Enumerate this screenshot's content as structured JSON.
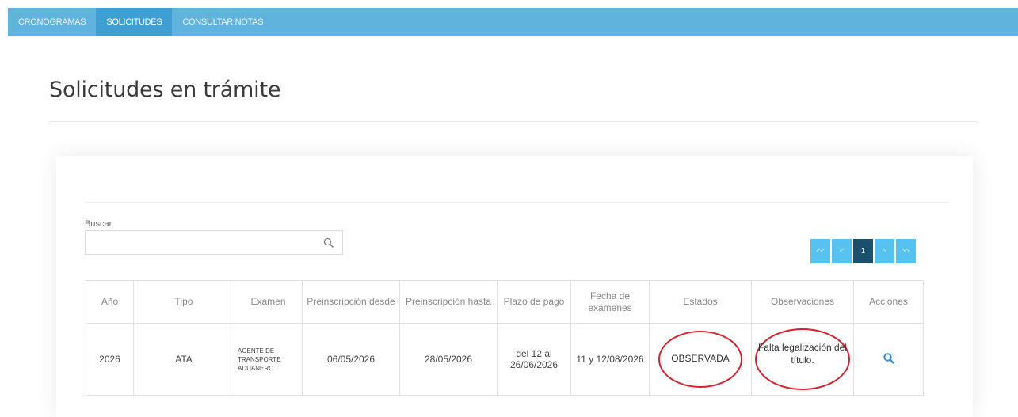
{
  "nav": {
    "items": [
      "CRONOGRAMAS",
      "SOLICITUDES",
      "CONSULTAR NOTAS"
    ],
    "active": "SOLICITUDES"
  },
  "page_title": "Solicitudes en trámite",
  "search": {
    "label": "Buscar",
    "value": "",
    "placeholder": ""
  },
  "pagination": {
    "first": "<<",
    "prev": "<",
    "current": "1",
    "next": ">",
    "last": ">>"
  },
  "table": {
    "headers": {
      "anio": "Año",
      "tipo": "Tipo",
      "examen": "Examen",
      "preins_desde": "Preinscripción desde",
      "preins_hasta": "Preinscripción hasta",
      "plazo_pago": "Plazo de pago",
      "fecha_examenes": "Fecha de exámenes",
      "estados": "Estados",
      "observaciones": "Observaciones",
      "acciones": "Acciones"
    },
    "rows": [
      {
        "anio": "2026",
        "tipo": "ATA",
        "examen": "AGENTE DE TRANSPORTE ADUANERO",
        "preins_desde": "06/05/2026",
        "preins_hasta": "28/05/2026",
        "plazo_pago": "del 12 al 26/06/2026",
        "fecha_examenes": "11 y 12/08/2026",
        "estado": "OBSERVADA",
        "observacion": "Falta legalización del título.",
        "accion_icon": "search-icon"
      }
    ]
  },
  "colors": {
    "nav_bg": "#5fb3dd",
    "nav_active": "#3d9fd2",
    "pager_bg": "#57c2ef",
    "pager_active": "#1c4f6c",
    "highlight_circle": "#d7232d",
    "action_icon": "#2f8fd8"
  }
}
